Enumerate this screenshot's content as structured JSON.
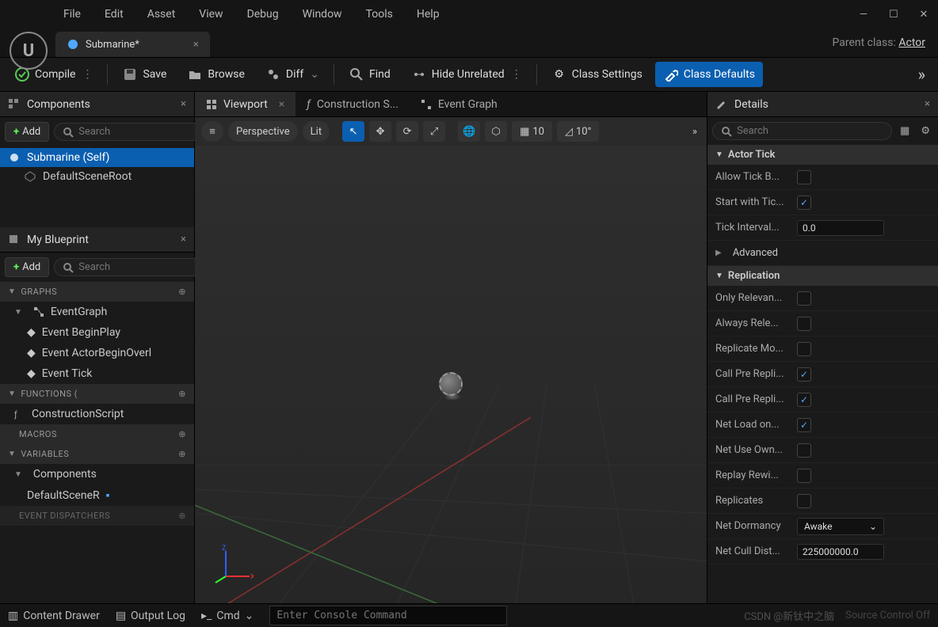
{
  "menu": [
    "File",
    "Edit",
    "Asset",
    "View",
    "Debug",
    "Window",
    "Tools",
    "Help"
  ],
  "tab": {
    "title": "Submarine*",
    "parent_label": "Parent class:",
    "parent_value": "Actor"
  },
  "toolbar": {
    "compile": "Compile",
    "save": "Save",
    "browse": "Browse",
    "diff": "Diff",
    "find": "Find",
    "hide": "Hide Unrelated",
    "class_settings": "Class Settings",
    "class_defaults": "Class Defaults"
  },
  "components": {
    "title": "Components",
    "add": "Add",
    "search_ph": "Search",
    "items": [
      {
        "label": "Submarine (Self)",
        "selected": true
      },
      {
        "label": "DefaultSceneRoot",
        "indent": true
      }
    ]
  },
  "myblueprint": {
    "title": "My Blueprint",
    "add": "Add",
    "search_ph": "Search",
    "sections": {
      "graphs": {
        "head": "GRAPHS",
        "root": "EventGraph",
        "items": [
          "Event BeginPlay",
          "Event ActorBeginOverl",
          "Event Tick"
        ]
      },
      "functions": {
        "head": "FUNCTIONS (",
        "items": [
          "ConstructionScript"
        ]
      },
      "macros": {
        "head": "MACROS"
      },
      "variables": {
        "head": "VARIABLES",
        "root": "Components",
        "items": [
          "DefaultSceneR"
        ]
      },
      "dispatchers": {
        "head": "EVENT DISPATCHERS"
      }
    }
  },
  "center_tabs": [
    {
      "label": "Viewport",
      "active": true,
      "closeable": true
    },
    {
      "label": "Construction S...",
      "icon": "fx",
      "closeable": false
    },
    {
      "label": "Event Graph",
      "icon": "graph",
      "closeable": false
    }
  ],
  "viewport": {
    "perspective": "Perspective",
    "lit": "Lit",
    "grid": "10",
    "angle": "10°"
  },
  "details": {
    "title": "Details",
    "search_ph": "Search",
    "cats": [
      {
        "name": "Actor Tick",
        "open": true,
        "props": [
          {
            "label": "Allow Tick B...",
            "type": "check",
            "value": false
          },
          {
            "label": "Start with Tic...",
            "type": "check",
            "value": true
          },
          {
            "label": "Tick Interval...",
            "type": "num",
            "value": "0.0"
          }
        ],
        "advanced": "Advanced"
      },
      {
        "name": "Replication",
        "open": true,
        "props": [
          {
            "label": "Only Relevan...",
            "type": "check",
            "value": false
          },
          {
            "label": "Always Rele...",
            "type": "check",
            "value": false
          },
          {
            "label": "Replicate Mo...",
            "type": "check",
            "value": false
          },
          {
            "label": "Call Pre Repli...",
            "type": "check",
            "value": true
          },
          {
            "label": "Call Pre Repli...",
            "type": "check",
            "value": true
          },
          {
            "label": "Net Load on...",
            "type": "check",
            "value": true
          },
          {
            "label": "Net Use Own...",
            "type": "check",
            "value": false
          },
          {
            "label": "Replay Rewi...",
            "type": "check",
            "value": false
          },
          {
            "label": "Replicates",
            "type": "check",
            "value": false
          },
          {
            "label": "Net Dormancy",
            "type": "dropdown",
            "value": "Awake"
          },
          {
            "label": "Net Cull Dist...",
            "type": "num",
            "value": "225000000.0"
          }
        ]
      }
    ]
  },
  "statusbar": {
    "content_drawer": "Content Drawer",
    "output_log": "Output Log",
    "cmd_label": "Cmd",
    "cmd_ph": "Enter Console Command",
    "source_control": "Source Control Off",
    "watermark": "CSDN @新钛中之脑"
  }
}
